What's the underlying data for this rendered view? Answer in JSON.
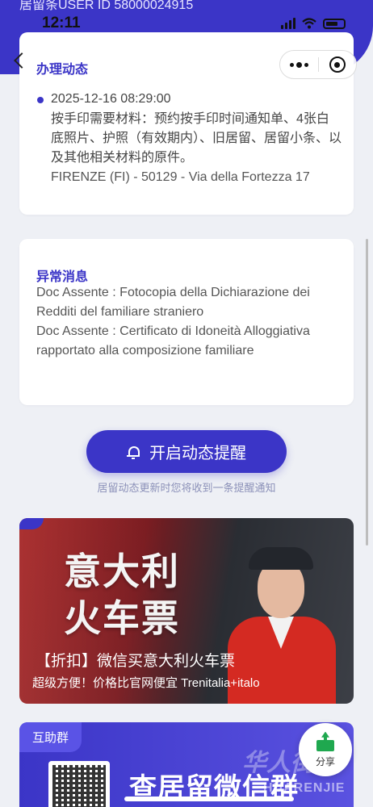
{
  "header": {
    "permit_id_text": "居留条USER ID  58000024915",
    "time": "12:11",
    "page_title": "办理动态"
  },
  "event": {
    "datetime": "2025-12-16 08:29:00",
    "description": "按手印需要材料：预约按手印时间通知单、4张白底照片、护照（有效期内）、旧居留、居留小条、以及其他相关材料的原件。",
    "address": "FIRENZE (FI) - 50129 - Via della Fortezza 17"
  },
  "anomaly": {
    "title": "异常消息",
    "lines": [
      "Doc Assente : Fotocopia della Dichiarazione dei Redditi del familiare straniero",
      "Doc Assente : Certificato di Idoneità Alloggiativa rapportato alla composizione familiare"
    ]
  },
  "reminder": {
    "button_label": "开启动态提醒",
    "hint": "居留动态更新时您将收到一条提醒通知"
  },
  "banner": {
    "title_line1": "意大利",
    "title_line2": "火车票",
    "subtitle": "【折扣】微信买意大利火车票",
    "subtext": "超级方便！价格比官网便宜 Trenitalia+italo"
  },
  "group": {
    "tag": "互助群",
    "title": "查居留微信群"
  },
  "share": {
    "label": "分享"
  },
  "colors": {
    "accent": "#3b35c7",
    "background": "#eef0f5"
  }
}
